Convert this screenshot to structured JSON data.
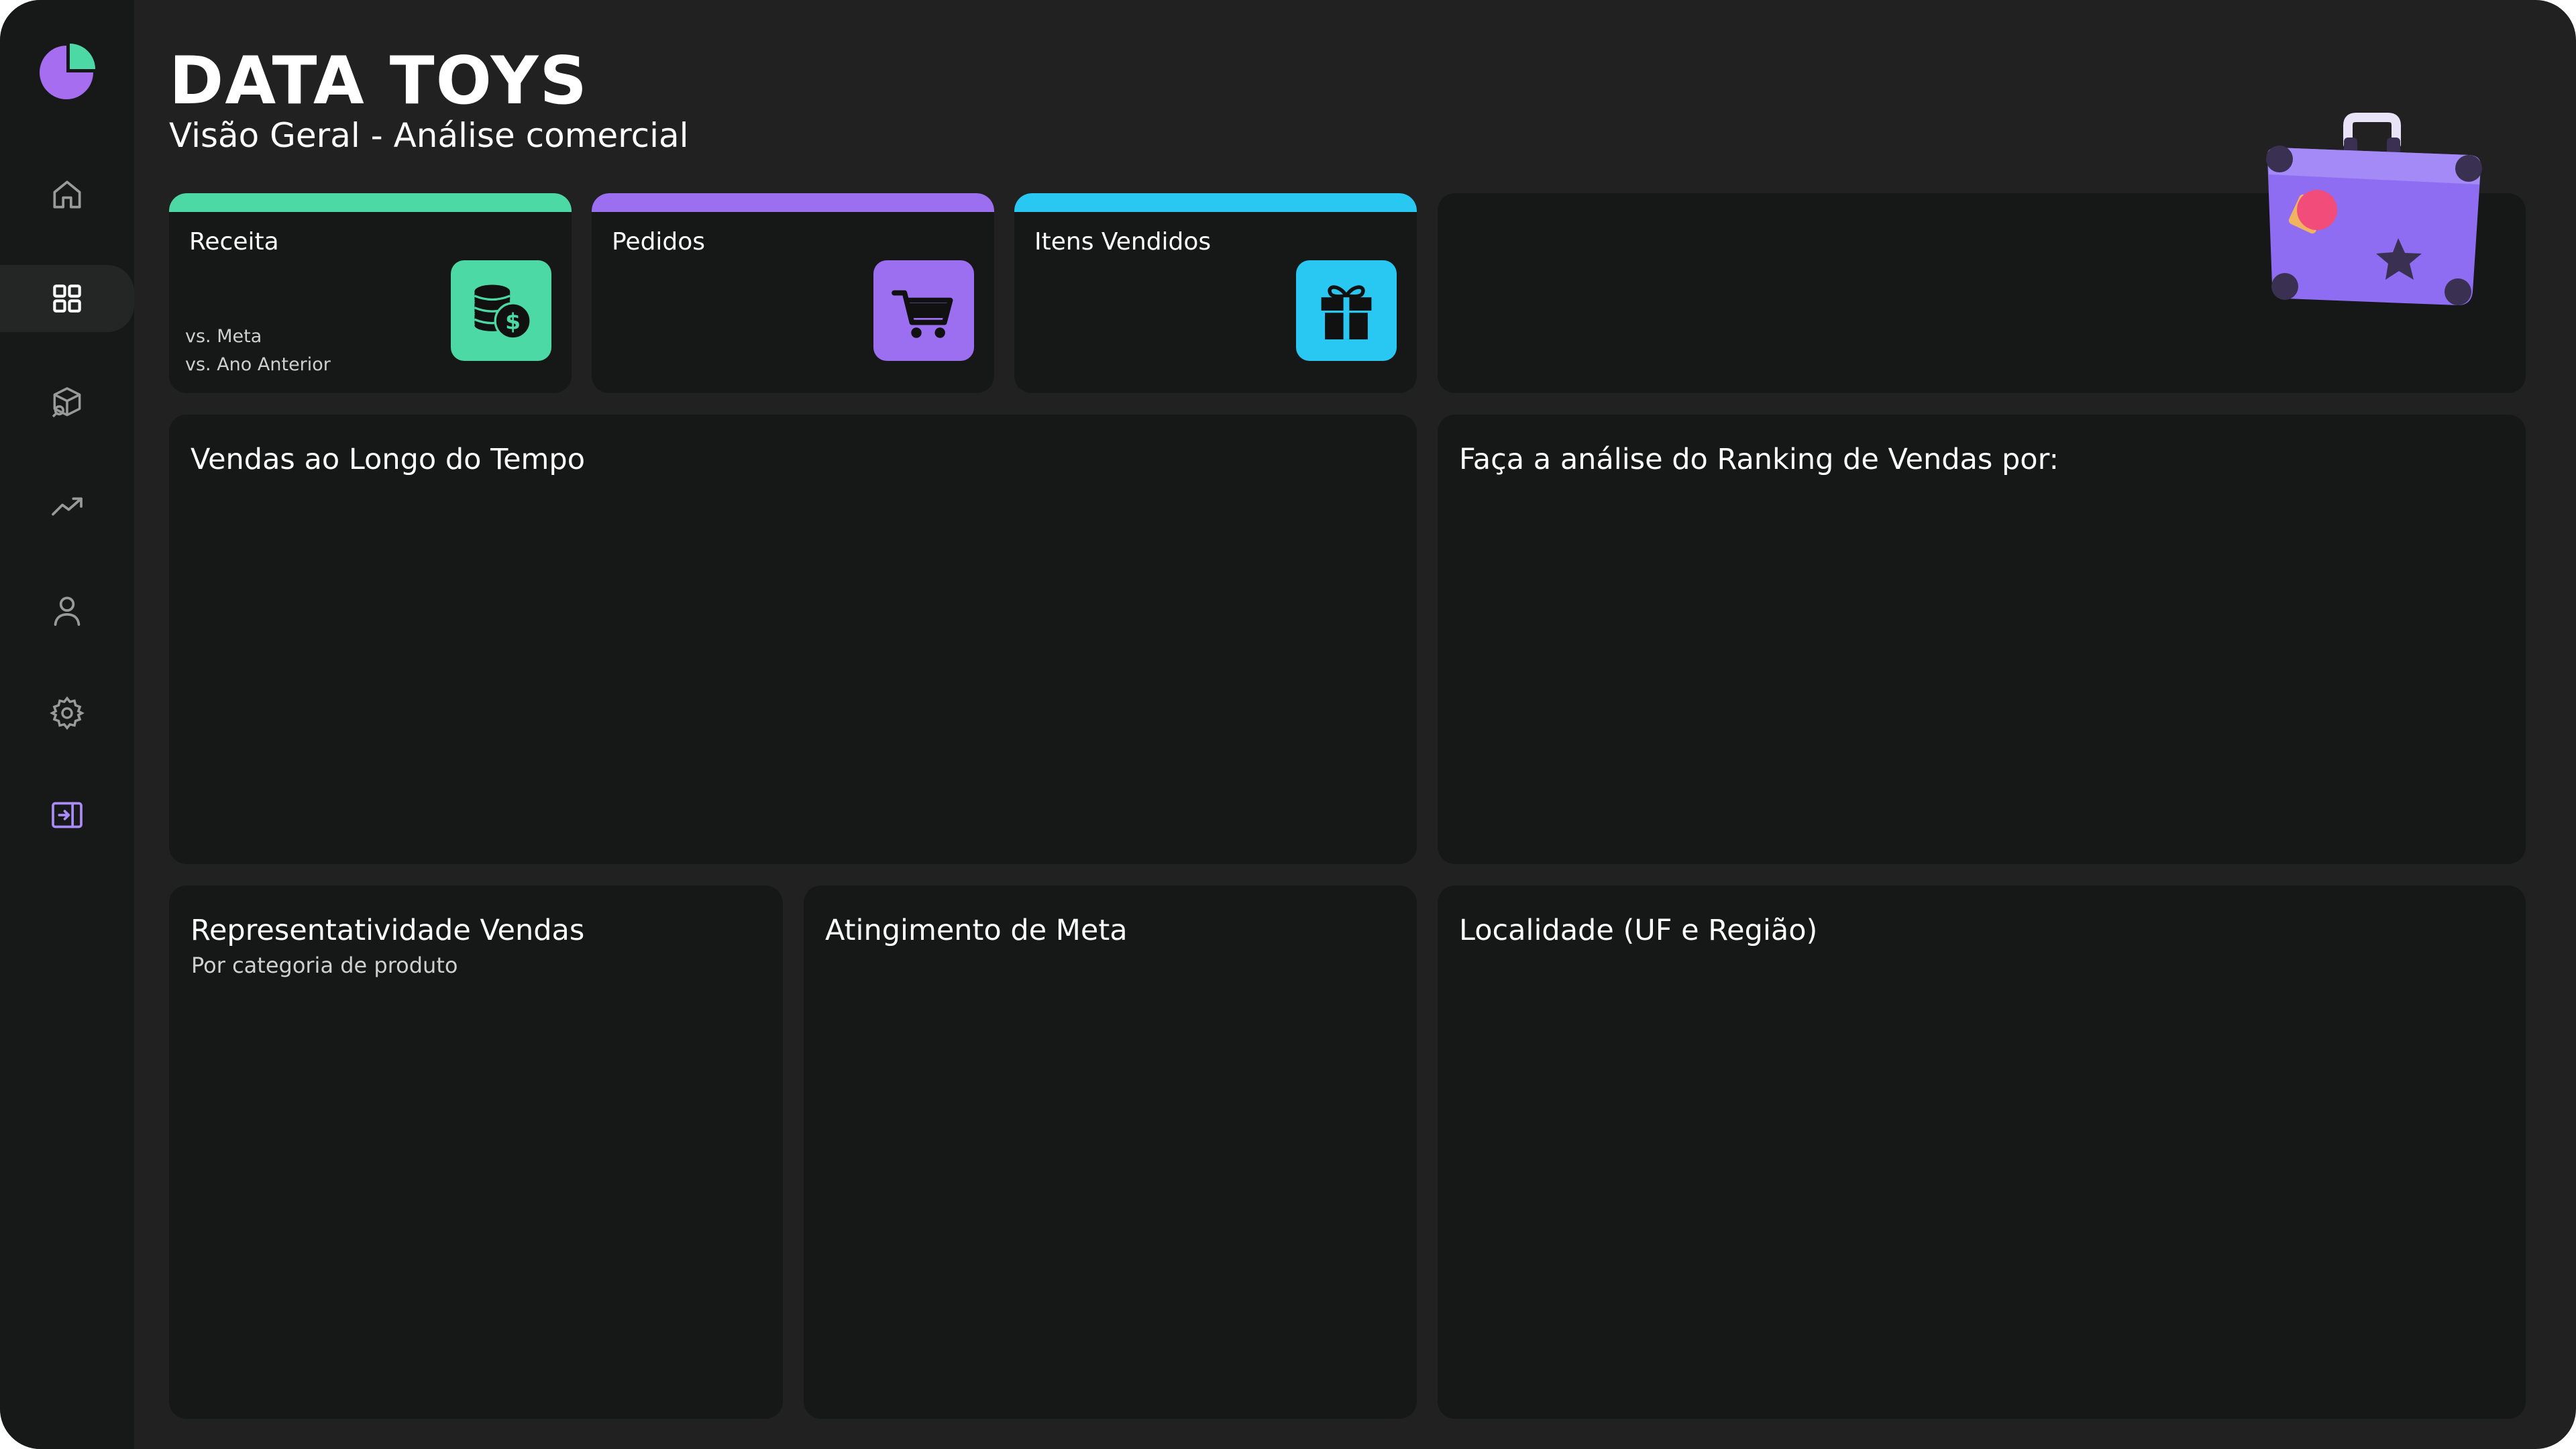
{
  "header": {
    "title": "DATA TOYS",
    "subtitle": "Visão Geral - Análise comercial"
  },
  "sidebar": {
    "items": [
      {
        "name": "home",
        "icon": "home-icon",
        "active": false
      },
      {
        "name": "overview",
        "icon": "grid-icon",
        "active": true
      },
      {
        "name": "products",
        "icon": "box-search-icon",
        "active": false
      },
      {
        "name": "trends",
        "icon": "trend-up-icon",
        "active": false
      },
      {
        "name": "user",
        "icon": "user-icon",
        "active": false
      },
      {
        "name": "settings",
        "icon": "gear-icon",
        "active": false
      },
      {
        "name": "exit",
        "icon": "sign-in-icon",
        "active": false
      }
    ],
    "accent": "#a98cf5"
  },
  "kpis": [
    {
      "label": "Receita",
      "color": "#4dd9a6",
      "icon": "coins-dollar-icon",
      "sub1": "vs. Meta",
      "sub2": "vs. Ano Anterior"
    },
    {
      "label": "Pedidos",
      "color": "#9c6ef0",
      "icon": "cart-icon"
    },
    {
      "label": "Itens Vendidos",
      "color": "#29c8f2",
      "icon": "gift-icon"
    }
  ],
  "panels": {
    "sales_over_time": {
      "title": "Vendas ao Longo do Tempo"
    },
    "ranking": {
      "title": "Faça a análise do Ranking de Vendas por:"
    },
    "representativeness": {
      "title": "Representatividade Vendas",
      "subtitle": "Por categoria de produto"
    },
    "goal": {
      "title": "Atingimento de Meta"
    },
    "locality": {
      "title": "Localidade (UF e Região)"
    }
  },
  "colors": {
    "background": "#212121",
    "sidebar": "#171818",
    "card": "#161717"
  }
}
